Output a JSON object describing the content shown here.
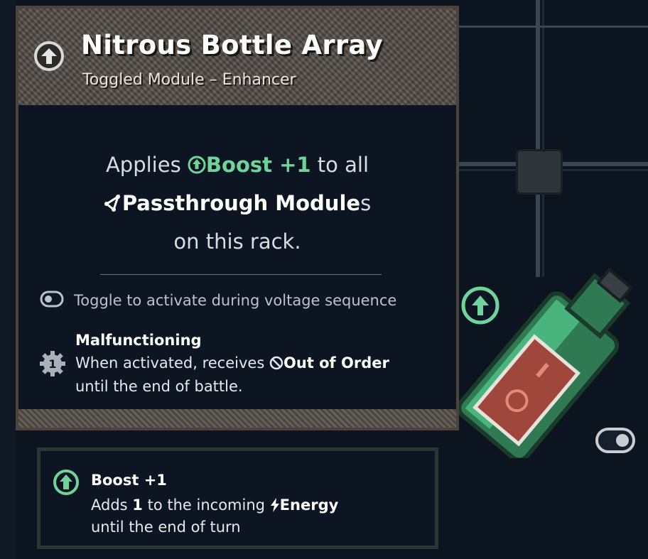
{
  "module": {
    "title": "Nitrous Bottle Array",
    "subtitle": "Toggled Module – Enhancer",
    "icon": "boost-arrow-icon"
  },
  "description": {
    "applies": "Applies",
    "boost_label": "Boost +1",
    "to_all": "to all",
    "passthrough_label": "Passthrough Module",
    "plural_suffix": "s",
    "on_rack": "on this rack."
  },
  "toggle": {
    "text": "Toggle to activate during voltage sequence",
    "icon": "toggle-switch-icon"
  },
  "malfunction": {
    "title": "Malfunctioning",
    "badge_number": "1",
    "line1_prefix": "When activated, receives",
    "status_label": "Out of Order",
    "line2": "until the end of battle."
  },
  "boost_tooltip": {
    "title": "Boost +1",
    "line1_prefix": "Adds",
    "amount": "1",
    "line1_mid": "to the incoming",
    "energy_label": "Energy",
    "line2": "until the end of turn"
  },
  "colors": {
    "boost_green": "#6fd49a",
    "panel_bg": "#0d1422",
    "header_rust": "#5d5650"
  }
}
